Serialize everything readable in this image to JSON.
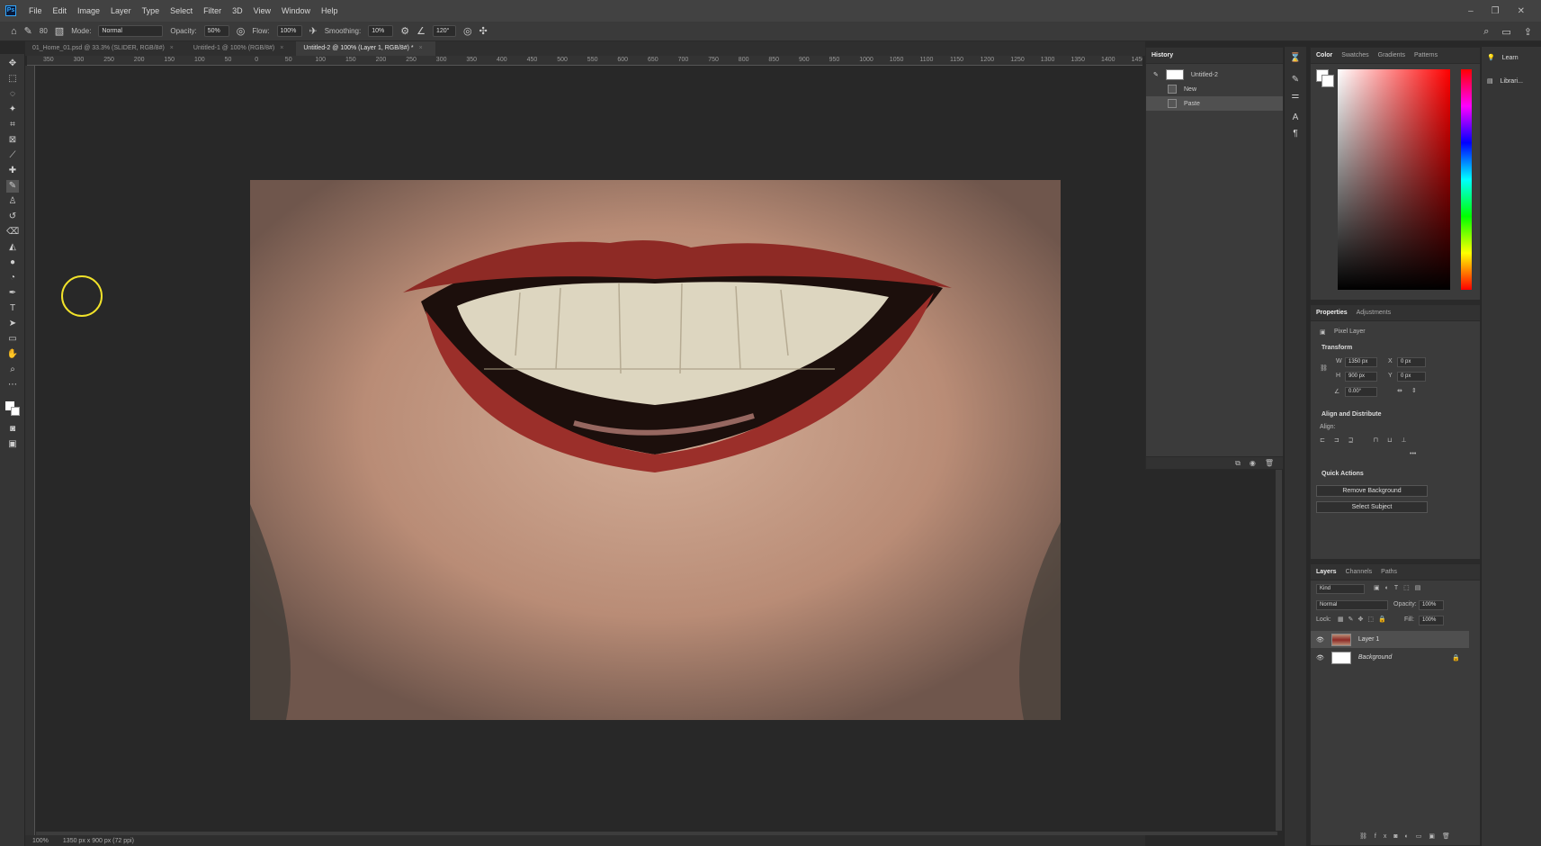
{
  "app": {
    "name": "Ps"
  },
  "menubar": [
    "File",
    "Edit",
    "Image",
    "Layer",
    "Type",
    "Select",
    "Filter",
    "3D",
    "View",
    "Window",
    "Help"
  ],
  "options": {
    "brush_size": "80",
    "mode_label": "Mode:",
    "mode_value": "Normal",
    "opacity_label": "Opacity:",
    "opacity_value": "50%",
    "flow_label": "Flow:",
    "flow_value": "100%",
    "smoothing_label": "Smoothing:",
    "smoothing_value": "10%",
    "angle_value": "120°"
  },
  "tabs": [
    {
      "label": "01_Home_01.psd @ 33.3% (SLIDER, RGB/8#)",
      "close": "×"
    },
    {
      "label": "Untitled-1 @ 100% (RGB/8#)",
      "close": "×"
    },
    {
      "label": "Untitled-2 @ 100% (Layer 1, RGB/8#) *",
      "close": "×"
    }
  ],
  "ruler": [
    "350",
    "300",
    "250",
    "200",
    "150",
    "100",
    "50",
    "0",
    "50",
    "100",
    "150",
    "200",
    "250",
    "300",
    "350",
    "400",
    "450",
    "500",
    "550",
    "600",
    "650",
    "700",
    "750",
    "800",
    "850",
    "900",
    "950",
    "1000",
    "1050",
    "1100",
    "1150",
    "1200",
    "1250",
    "1300",
    "1350",
    "1400",
    "1450"
  ],
  "status": {
    "zoom": "100%",
    "size": "1350 px x 900 px (72 ppi)"
  },
  "history": {
    "tab": "History",
    "snapshot": "Untitled-2",
    "steps": [
      "New",
      "Paste"
    ]
  },
  "color_panel": {
    "tabs": [
      "Color",
      "Swatches",
      "Gradients",
      "Patterns"
    ]
  },
  "properties": {
    "tabs": [
      "Properties",
      "Adjustments"
    ],
    "type": "Pixel Layer",
    "transform_title": "Transform",
    "w_label": "W",
    "w_value": "1350 px",
    "h_label": "H",
    "h_value": "900 px",
    "x_label": "X",
    "x_value": "0 px",
    "y_label": "Y",
    "y_value": "0 px",
    "angle_value": "0.00°",
    "align_title": "Align and Distribute",
    "align_label": "Align:",
    "qa_title": "Quick Actions",
    "qa_remove_bg": "Remove Background",
    "qa_select_subject": "Select Subject"
  },
  "layers": {
    "tabs": [
      "Layers",
      "Channels",
      "Paths"
    ],
    "filter_kind": "Kind",
    "blend_mode": "Normal",
    "opacity_label": "Opacity:",
    "opacity_value": "100%",
    "lock_label": "Lock:",
    "fill_label": "Fill:",
    "fill_value": "100%",
    "items": [
      {
        "name": "Layer 1",
        "selected": true
      },
      {
        "name": "Background",
        "selected": false
      }
    ]
  },
  "far_right": {
    "learn": "Learn",
    "libraries": "Librari..."
  }
}
